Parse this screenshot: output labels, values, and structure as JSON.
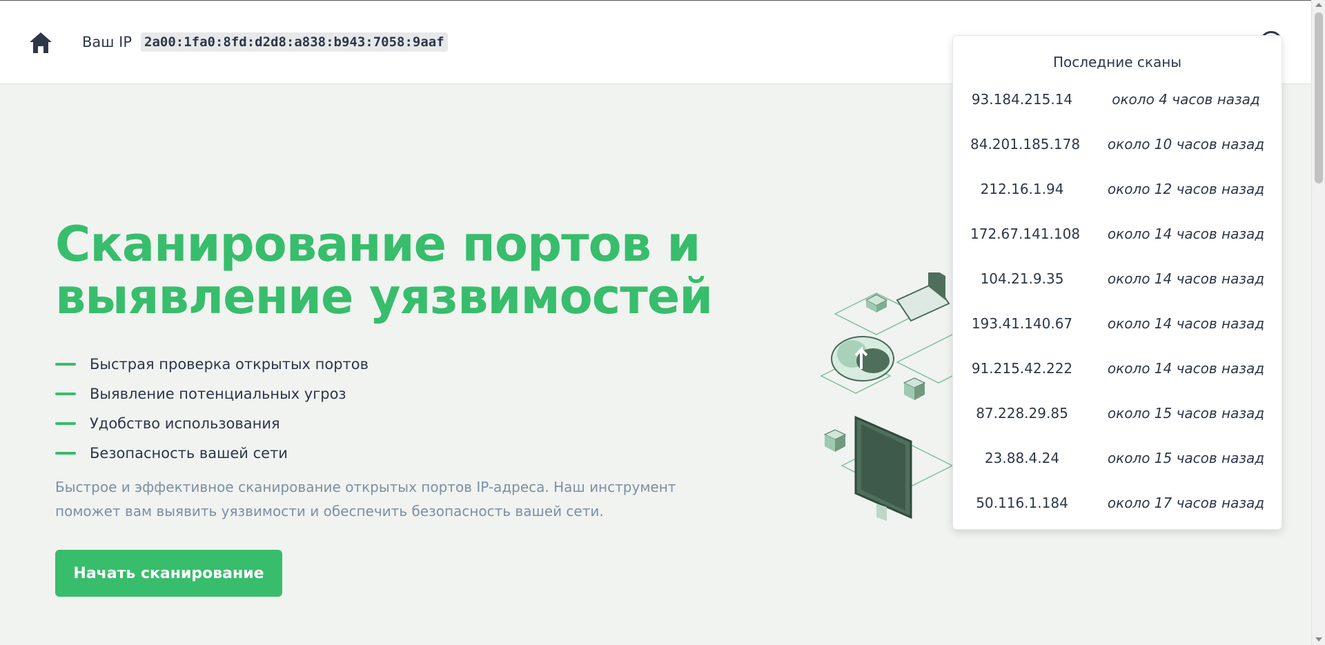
{
  "header": {
    "ip_label": "Ваш IP",
    "ip_value": "2a00:1fa0:8fd:d2d8:a838:b943:7058:9aaf"
  },
  "hero": {
    "title_line1": "Сканирование портов и",
    "title_line2": "выявление уязвимостей",
    "features": [
      "Быстрая проверка открытых портов",
      "Выявление потенциальных угроз",
      "Удобство использования",
      "Безопасность вашей сети"
    ],
    "description": "Быстрое и эффективное сканирование открытых портов IP-адреса. Наш инструмент поможет вам выявить уязвимости и обеспечить безопасность вашей сети.",
    "cta_label": "Начать сканирование"
  },
  "recent_scans": {
    "title": "Последние сканы",
    "items": [
      {
        "ip": "93.184.215.14",
        "time": "около 4 часов назад"
      },
      {
        "ip": "84.201.185.178",
        "time": "около 10 часов назад"
      },
      {
        "ip": "212.16.1.94",
        "time": "около 12 часов назад"
      },
      {
        "ip": "172.67.141.108",
        "time": "около 14 часов назад"
      },
      {
        "ip": "104.21.9.35",
        "time": "около 14 часов назад"
      },
      {
        "ip": "193.41.140.67",
        "time": "около 14 часов назад"
      },
      {
        "ip": "91.215.42.222",
        "time": "около 14 часов назад"
      },
      {
        "ip": "87.228.29.85",
        "time": "около 15 часов назад"
      },
      {
        "ip": "23.88.4.24",
        "time": "около 15 часов назад"
      },
      {
        "ip": "50.116.1.184",
        "time": "около 17 часов назад"
      }
    ]
  },
  "colors": {
    "accent": "#38bd6c",
    "text": "#2d3748",
    "muted": "#7c8fa3",
    "background": "#f0f3f0"
  },
  "icons": {
    "home": "home-icon",
    "help": "help-icon"
  }
}
